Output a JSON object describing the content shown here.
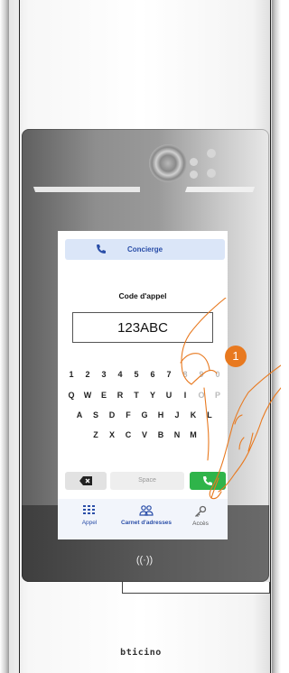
{
  "screen": {
    "concierge_label": "Concierge",
    "code_title": "Code d'appel",
    "code_value": "123ABC"
  },
  "keyboard": {
    "row1": [
      "1",
      "2",
      "3",
      "4",
      "5",
      "6",
      "7",
      "8",
      "9",
      "0"
    ],
    "row2": [
      "Q",
      "W",
      "E",
      "R",
      "T",
      "Y",
      "U",
      "I",
      "O",
      "P"
    ],
    "row3": [
      "A",
      "S",
      "D",
      "F",
      "G",
      "H",
      "J",
      "K",
      "L"
    ],
    "row4": [
      "Z",
      "X",
      "C",
      "V",
      "B",
      "N",
      "M"
    ],
    "space_label": "Space"
  },
  "nav": {
    "items": [
      {
        "label": "Appel",
        "icon": "grid-icon"
      },
      {
        "label": "Carnet d'adresses",
        "icon": "contacts-icon"
      },
      {
        "label": "Accès",
        "icon": "key-icon"
      }
    ]
  },
  "step_badge": "1",
  "nfc_symbol": "((·))",
  "brand_logo": "bticino",
  "colors": {
    "accent": "#2a4ea8",
    "call_key": "#2fb44a",
    "badge": "#e8791f"
  }
}
